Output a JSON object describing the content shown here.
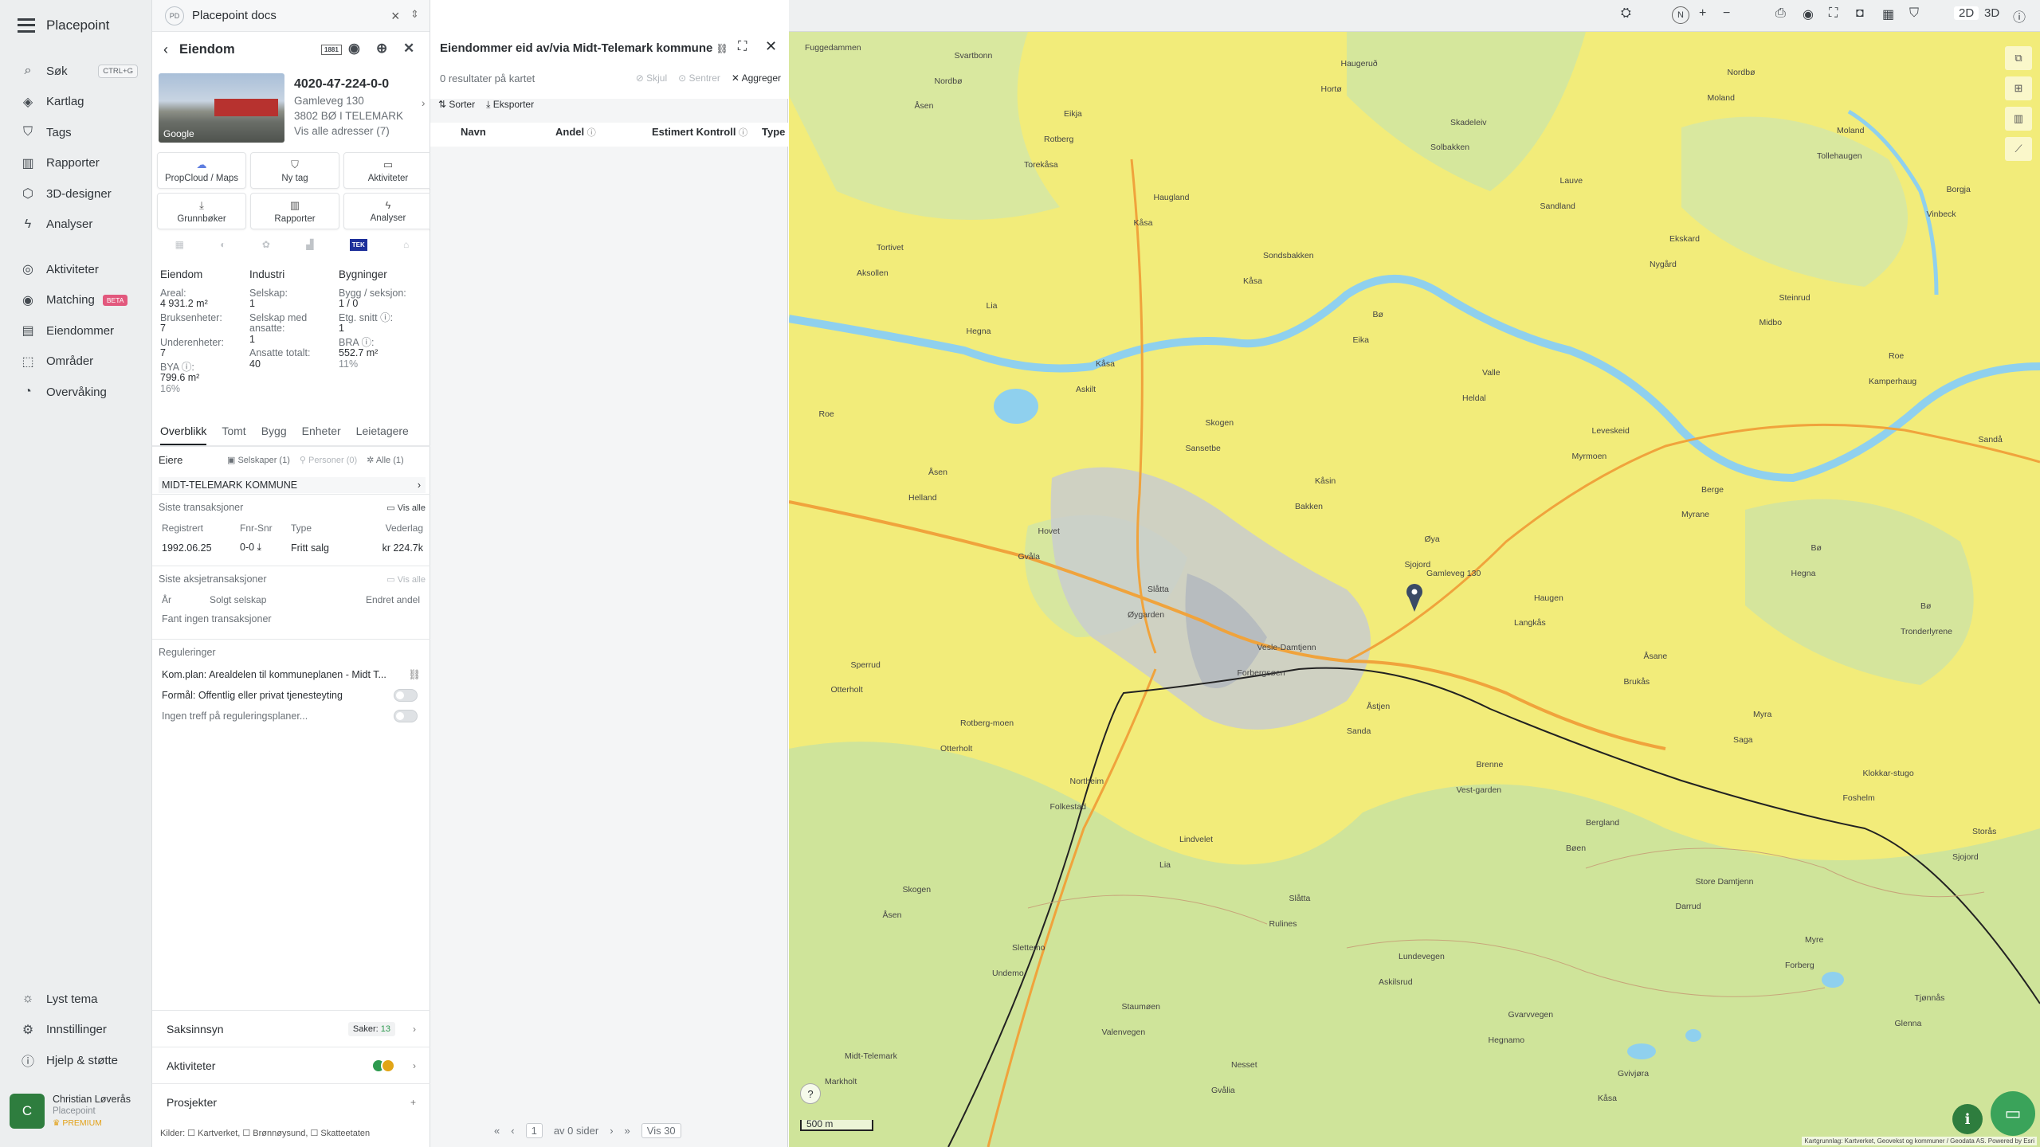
{
  "nav": {
    "brand": "Placepoint",
    "items": [
      {
        "label": "Søk",
        "kbd": "CTRL+G"
      },
      {
        "label": "Kartlag"
      },
      {
        "label": "Tags"
      },
      {
        "label": "Rapporter"
      },
      {
        "label": "3D-designer"
      },
      {
        "label": "Analyser"
      },
      {
        "label": "Aktiviteter"
      },
      {
        "label": "Matching",
        "badge": "BETA"
      },
      {
        "label": "Eiendommer"
      },
      {
        "label": "Områder"
      },
      {
        "label": "Overvåking"
      }
    ],
    "bottom": [
      {
        "label": "Lyst tema"
      },
      {
        "label": "Innstillinger"
      },
      {
        "label": "Hjelp & støtte"
      }
    ],
    "user": {
      "initial": "C",
      "name": "Christian Løverås",
      "org": "Placepoint",
      "plan": "PREMIUM"
    }
  },
  "doc": {
    "badge": "PD",
    "title": "Placepoint docs"
  },
  "property": {
    "header": "Eiendom",
    "header_badge": "1881",
    "id": "4020-47-224-0-0",
    "address": "Gamleveg 130",
    "city": "3802 BØ I TELEMARK",
    "all_addresses": "Vis alle adresser (7)",
    "photo_label": "Google",
    "tiles": [
      "PropCloud / Maps",
      "Ny tag",
      "Aktiviteter",
      "Grunnbøker",
      "Rapporter",
      "Analyser"
    ],
    "tek": "TEK",
    "stats": {
      "col1": {
        "title": "Eiendom",
        "items": [
          {
            "label": "Areal:",
            "value": "4 931.2 m²"
          },
          {
            "label": "Bruksenheter:",
            "value": "7"
          },
          {
            "label": "Underenheter:",
            "value": "7"
          },
          {
            "label": "BYA ⓘ:",
            "value": "799.6 m²",
            "pct": "16%"
          }
        ]
      },
      "col2": {
        "title": "Industri",
        "items": [
          {
            "label": "Selskap:",
            "value": "1"
          },
          {
            "label": "Selskap med ansatte:",
            "value": "1"
          },
          {
            "label": "Ansatte totalt:",
            "value": "40"
          }
        ]
      },
      "col3": {
        "title": "Bygninger",
        "items": [
          {
            "label": "Bygg / seksjon:",
            "value": "1 / 0"
          },
          {
            "label": "Etg. snitt ⓘ:",
            "value": "1"
          },
          {
            "label": "BRA ⓘ:",
            "value": "552.7 m²",
            "pct": "11%"
          }
        ]
      }
    },
    "tabs": [
      "Overblikk",
      "Tomt",
      "Bygg",
      "Enheter",
      "Leietagere"
    ],
    "owners": {
      "title": "Eiere",
      "companies": "Selskaper (1)",
      "persons": "Personer (0)",
      "all": "Alle (1)",
      "owner": "MIDT-TELEMARK KOMMUNE"
    },
    "transactions": {
      "title": "Siste transaksjoner",
      "show_all": "Vis alle",
      "headers": [
        "Registrert",
        "Fnr-Snr",
        "Type",
        "Vederlag"
      ],
      "row": [
        "1992.06.25",
        "0-0 ⤓",
        "Fritt salg",
        "kr 224.7k"
      ]
    },
    "share_tx": {
      "title": "Siste aksjetransaksjoner",
      "show_all": "Vis alle",
      "headers": [
        "År",
        "Solgt selskap",
        "Endret andel"
      ],
      "empty": "Fant ingen transaksjoner"
    },
    "regulations": {
      "title": "Reguleringer",
      "plan": "Kom.plan: Arealdelen til kommuneplanen - Midt T...",
      "purpose": "Formål: Offentlig eller privat tjenesteyting",
      "none": "Ingen treff på reguleringsplaner..."
    },
    "bottom": {
      "saksinnsyn": "Saksinnsyn",
      "saker_label": "Saker:",
      "saker_count": "13",
      "aktiviteter": "Aktiviteter",
      "prosjekter": "Prosjekter"
    },
    "sources": "Kilder: ☐ Kartverket, ☐ Brønnøysund, ☐ Skatteetaten"
  },
  "results": {
    "title": "Eiendommer eid av/via Midt-Telemark kommune",
    "count": "0 resultater på kartet",
    "tools": [
      "Skjul",
      "Sentrer",
      "Aggreger"
    ],
    "bar": [
      "Sorter",
      "Eksporter"
    ],
    "columns": [
      "Navn",
      "Andel",
      "Estimert Kontroll",
      "Type"
    ],
    "pager": {
      "page": "1",
      "of": "av 0 sider",
      "show": "Vis 30"
    }
  },
  "map": {
    "toolbar": {
      "mode2d": "2D",
      "mode3d": "3D",
      "north": "N"
    },
    "scale": "500 m",
    "attribution": "Kartgrunnlag: Kartverket, Geovekst og kommuner / Geodata AS. Powered by Esri",
    "place_labels": [
      "Fuggedammen",
      "Åsen",
      "Torekåsa",
      "Kåsa",
      "Kåsa",
      "Eika",
      "Heldal",
      "Myrmoen",
      "Myrane",
      "Hegna",
      "Tronderlyrene",
      "Otterholt",
      "Otterholt",
      "Folkestad",
      "Lia",
      "Rulines",
      "Askilsrud",
      "Hegnamo",
      "Kåsa",
      "Moland",
      "Tollehaugen",
      "Vinbeck",
      "Aksollen",
      "Hegna",
      "Askilt",
      "Sansetbe",
      "Bakken",
      "Sjojord",
      "Langkås",
      "Brukås",
      "Saga",
      "Foshelm",
      "Sjojord",
      "Åsen",
      "Undemo",
      "Valenvegen",
      "Gvålia",
      "Hortø",
      "Solbakken",
      "Sandland",
      "Nygård",
      "Midbo",
      "Kamperhaug",
      "Sandå",
      "Helland",
      "Gvåla",
      "Øygarden",
      "Forbergsøen",
      "Sanda",
      "Vest-garden",
      "Bøen",
      "Darrud",
      "Forberg",
      "Glenna",
      "Markholt",
      "Nordbø",
      "Rotberg",
      "Haugland",
      "Sondsbakken",
      "Bø",
      "Valle",
      "Leveskeid",
      "Berge",
      "Bø",
      "Bø",
      "Sperrud",
      "Rotberg-moen",
      "Northeim",
      "Lindvelet",
      "Slåtta",
      "Lundevegen",
      "Gvarvvegen",
      "Gvivjøra",
      "Nordbø",
      "Moland",
      "Borgja",
      "Tortivet",
      "Lia",
      "Kåsa",
      "Skogen",
      "Kåsin",
      "Øya",
      "Haugen",
      "Åsane",
      "Myra",
      "Klokkar-stugo",
      "Storås",
      "Skogen",
      "Slettemo",
      "Staumøen",
      "Nesset",
      "Haugeruð",
      "Skadeleiv",
      "Lauve",
      "Ekskard",
      "Steinrud",
      "Roe",
      "Roe",
      "Åsen",
      "Hovet",
      "Slåtta",
      "Vesle-Damtjenn",
      "Åstjen",
      "Brenne",
      "Bergland",
      "Store Damtjenn",
      "Myre",
      "Tjønnås",
      "Midt-Telemark",
      "Svartbonn",
      "Eikja"
    ],
    "marker_label": "Gamleveg 130"
  }
}
